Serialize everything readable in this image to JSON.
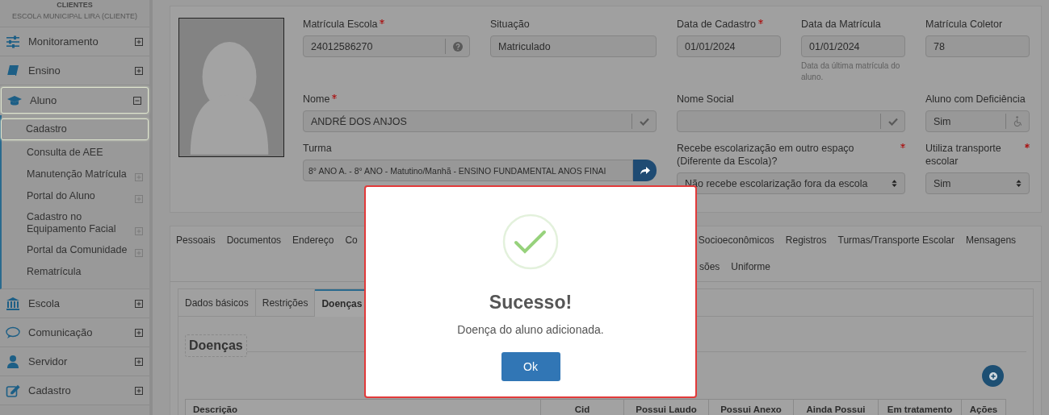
{
  "sidebar": {
    "header": "CLIENTES",
    "school": "ESCOLA MUNICIPAL LIRA (CLIENTE)",
    "items": [
      {
        "label": "Monitoramento",
        "expanded": false,
        "selected": false
      },
      {
        "label": "Ensino",
        "expanded": false,
        "selected": false
      },
      {
        "label": "Aluno",
        "expanded": true,
        "selected": true,
        "children": [
          {
            "label": "Cadastro",
            "expandable": false,
            "selected": true
          },
          {
            "label": "Consulta de AEE",
            "expandable": false,
            "selected": false
          },
          {
            "label": "Manutenção Matrícula",
            "expandable": true,
            "selected": false
          },
          {
            "label": "Portal do Aluno",
            "expandable": true,
            "selected": false
          },
          {
            "label": "Cadastro no Equipamento Facial",
            "expandable": true,
            "selected": false
          },
          {
            "label": "Portal da Comunidade",
            "expandable": true,
            "selected": false
          },
          {
            "label": "Rematrícula",
            "expandable": false,
            "selected": false
          }
        ]
      },
      {
        "label": "Escola",
        "expanded": false,
        "selected": false
      },
      {
        "label": "Comunicação",
        "expanded": false,
        "selected": false
      },
      {
        "label": "Servidor",
        "expanded": false,
        "selected": false
      },
      {
        "label": "Cadastro",
        "expanded": false,
        "selected": false
      }
    ]
  },
  "form": {
    "fields": [
      {
        "label": "Matrícula Escola",
        "required": true,
        "value": "24012586270",
        "kind": "help-input"
      },
      {
        "label": "Situação",
        "required": false,
        "value": "Matriculado",
        "kind": "text"
      },
      {
        "label": "Data de Cadastro",
        "required": true,
        "value": "01/01/2024",
        "kind": "text"
      },
      {
        "label": "Data da Matrícula",
        "required": false,
        "value": "01/01/2024",
        "kind": "text",
        "hint": "Data da última matrícula do aluno."
      },
      {
        "label": "Matrícula Coletor",
        "required": false,
        "value": "78",
        "kind": "text"
      },
      {
        "label": "Nome",
        "required": true,
        "value": "ANDRÉ DOS ANJOS",
        "kind": "validated-input"
      },
      {
        "label": "Nome Social",
        "required": false,
        "kind": "validated-input"
      },
      {
        "label": "Aluno com Deficiência",
        "required": false,
        "value": "Sim",
        "kind": "accessibility-input"
      },
      {
        "label": "Turma",
        "required": false,
        "value": "8° ANO A. - 8° ANO - Matutino/Manhã - ENSINO FUNDAMENTAL ANOS FINAI",
        "kind": "action-input"
      },
      {
        "label": "Recebe escolarização em outro espaço (Diferente da Escola)?",
        "required": true,
        "value": "Não recebe escolarização fora da escola",
        "kind": "select"
      },
      {
        "label": "Utiliza transporte escolar",
        "required": true,
        "value": "Sim",
        "kind": "select"
      }
    ]
  },
  "record_tabs": [
    [
      {
        "label": "Pessoais",
        "selected": false
      },
      {
        "label": "Documentos",
        "selected": false
      },
      {
        "label": "Endereço",
        "selected": false
      },
      {
        "label": "Co",
        "selected": false
      },
      {
        "label": "Socioeconômicos",
        "selected": false
      },
      {
        "label": "Registros",
        "selected": false
      },
      {
        "label": "Turmas/Transporte Escolar",
        "selected": false
      },
      {
        "label": "Mensagens",
        "selected": false
      }
    ],
    [
      {
        "label": "sões",
        "selected": false
      },
      {
        "label": "Uniforme",
        "selected": false
      }
    ]
  ],
  "sub_tabs": [
    {
      "label": "Dados básicos",
      "selected": false
    },
    {
      "label": "Restrições",
      "selected": false
    },
    {
      "label": "Doenças",
      "selected": true
    }
  ],
  "section_title": "Doenças",
  "table": {
    "columns": [
      "Descrição",
      "Cid",
      "Possui Laudo",
      "Possui Anexo",
      "Ainda Possui",
      "Em tratamento",
      "Ações"
    ]
  },
  "dialog": {
    "title": "Sucesso!",
    "message": "Doença do aluno adicionada.",
    "button": "Ok"
  }
}
